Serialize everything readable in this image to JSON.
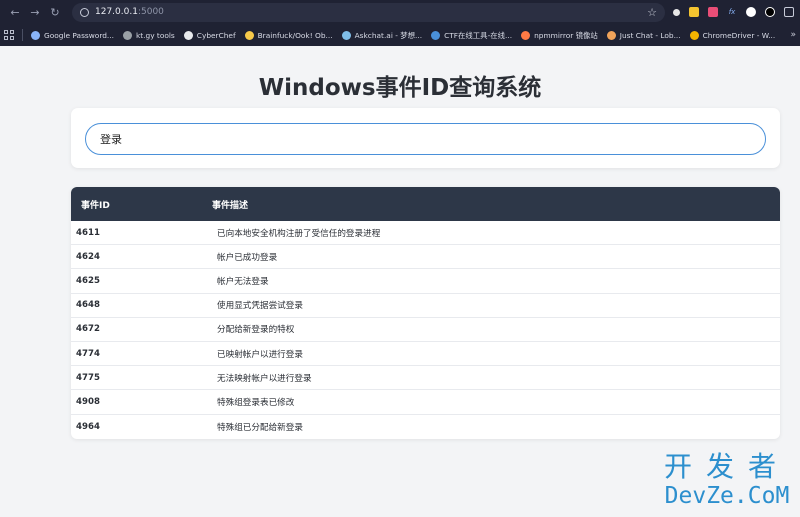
{
  "browser": {
    "url_host": "127.0.0.1",
    "url_port": ":5000",
    "bookmarks": [
      {
        "label": "Google Password...",
        "color": "#8ab4f8"
      },
      {
        "label": "kt.gy tools",
        "color": "#9aa0a6"
      },
      {
        "label": "CyberChef",
        "color": "#e8eaed"
      },
      {
        "label": "Brainfuck/Ook! Ob...",
        "color": "#f6c94a"
      },
      {
        "label": "Askchat.ai - 梦想...",
        "color": "#7fbde8"
      },
      {
        "label": "CTF在线工具-在线...",
        "color": "#4a90d9"
      },
      {
        "label": "npmmirror 镜像站",
        "color": "#ff7a45"
      },
      {
        "label": "Just Chat - Lob...",
        "color": "#f0a35a"
      },
      {
        "label": "ChromeDriver - W...",
        "color": "#f4b400"
      }
    ],
    "more": "»"
  },
  "page": {
    "title": "Windows事件ID查询系统",
    "search_value": "登录"
  },
  "table": {
    "headers": [
      "事件ID",
      "事件描述"
    ],
    "rows": [
      {
        "id": "4611",
        "desc": "已向本地安全机构注册了受信任的登录进程"
      },
      {
        "id": "4624",
        "desc": "帐户已成功登录"
      },
      {
        "id": "4625",
        "desc": "帐户无法登录"
      },
      {
        "id": "4648",
        "desc": "使用显式凭据尝试登录"
      },
      {
        "id": "4672",
        "desc": "分配给新登录的特权"
      },
      {
        "id": "4774",
        "desc": "已映射帐户以进行登录"
      },
      {
        "id": "4775",
        "desc": "无法映射帐户以进行登录"
      },
      {
        "id": "4908",
        "desc": "特殊组登录表已修改"
      },
      {
        "id": "4964",
        "desc": "特殊组已分配给新登录"
      }
    ]
  },
  "watermark": {
    "cn": "开发者",
    "en": "DevZe.CoM"
  }
}
